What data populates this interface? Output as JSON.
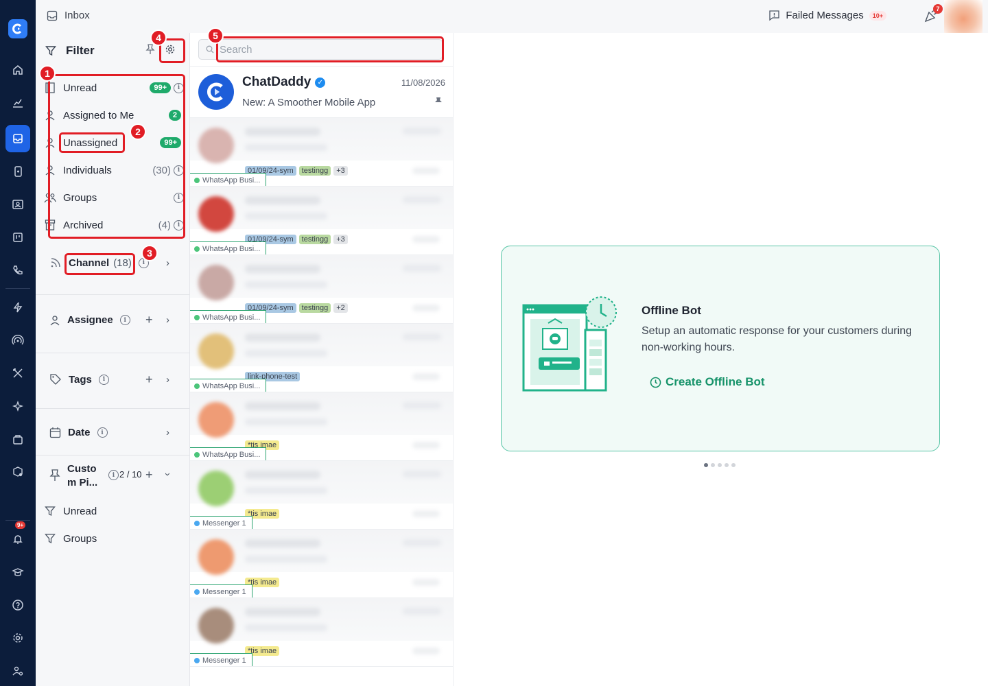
{
  "topbar": {
    "inbox_label": "Inbox",
    "failed_label": "Failed Messages",
    "failed_count": "10+",
    "notif_count": "7"
  },
  "rail": {
    "notif_badge": "9+"
  },
  "filter": {
    "title": "Filter",
    "items": [
      {
        "label": "Unread",
        "pill": "99+",
        "count": ""
      },
      {
        "label": "Assigned to Me",
        "pill": "2",
        "count": ""
      },
      {
        "label": "Unassigned",
        "pill": "99+",
        "count": ""
      },
      {
        "label": "Individuals",
        "pill": "",
        "count": "(30)"
      },
      {
        "label": "Groups",
        "pill": "",
        "count": ""
      },
      {
        "label": "Archived",
        "pill": "",
        "count": "(4)"
      }
    ],
    "channel_label": "Channel",
    "channel_count": "(18)",
    "assignee_label": "Assignee",
    "tags_label": "Tags",
    "date_label": "Date",
    "custom_label": "Custo m Pi...",
    "custom_count": "2 / 10",
    "custom_items": [
      "Unread",
      "Groups"
    ]
  },
  "annotations": [
    "1",
    "2",
    "3",
    "4",
    "5"
  ],
  "search": {
    "placeholder": "Search"
  },
  "pinned": {
    "name": "ChatDaddy",
    "date": "11/08/2026",
    "message": "New: A Smoother Mobile App"
  },
  "conversations": [
    {
      "tags": [
        "01/09/24-sym",
        "testingg",
        "+3"
      ],
      "channel": "WhatsApp Busi...",
      "avatar": "#d9b4b0"
    },
    {
      "tags": [
        "01/09/24-sym",
        "testingg",
        "+3"
      ],
      "channel": "WhatsApp Busi...",
      "avatar": "#d2473f"
    },
    {
      "tags": [
        "01/09/24-sym",
        "testingg",
        "+2"
      ],
      "channel": "WhatsApp Busi...",
      "avatar": "#c9a9a5"
    },
    {
      "tags": [
        "link-phone-test"
      ],
      "channel": "WhatsApp Busi...",
      "avatar": "#e2c07a"
    },
    {
      "tags": [
        "*tis imae"
      ],
      "channel": "WhatsApp Busi...",
      "avatar": "#ef9c76"
    },
    {
      "tags": [
        "*tis imae"
      ],
      "channel": "Messenger 1",
      "avatar": "#9ccf74"
    },
    {
      "tags": [
        "*tis imae"
      ],
      "channel": "Messenger 1",
      "avatar": "#ee9a70"
    },
    {
      "tags": [
        "*tis imae"
      ],
      "channel": "Messenger 1",
      "avatar": "#a88d7c"
    }
  ],
  "card": {
    "title": "Offline Bot",
    "description": "Setup an automatic response for your customers during non-working hours.",
    "button": "Create Offline Bot"
  },
  "colors": {
    "rail": "#0c1d3b",
    "accent": "#1f64e6",
    "green": "#1faa6b",
    "annotation": "#e11d25",
    "teal": "#17936a"
  }
}
